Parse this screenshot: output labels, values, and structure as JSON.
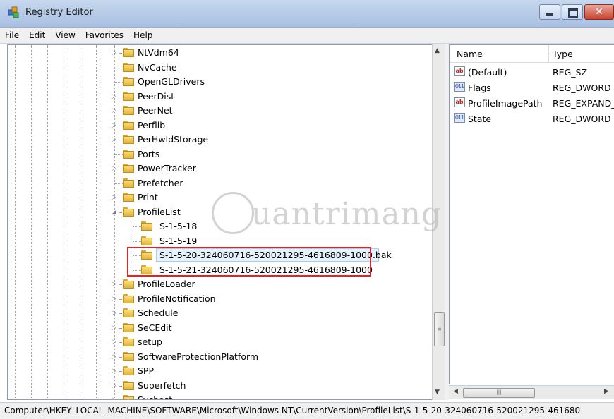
{
  "window": {
    "title": "Registry Editor"
  },
  "menu": [
    "File",
    "Edit",
    "View",
    "Favorites",
    "Help"
  ],
  "tree": {
    "items": [
      {
        "label": "NtVdm64",
        "expander": "▷",
        "level": 0
      },
      {
        "label": "NvCache",
        "expander": "",
        "level": 0
      },
      {
        "label": "OpenGLDrivers",
        "expander": "",
        "level": 0
      },
      {
        "label": "PeerDist",
        "expander": "▷",
        "level": 0
      },
      {
        "label": "PeerNet",
        "expander": "▷",
        "level": 0
      },
      {
        "label": "Perflib",
        "expander": "▷",
        "level": 0
      },
      {
        "label": "PerHwIdStorage",
        "expander": "▷",
        "level": 0
      },
      {
        "label": "Ports",
        "expander": "",
        "level": 0
      },
      {
        "label": "PowerTracker",
        "expander": "▷",
        "level": 0
      },
      {
        "label": "Prefetcher",
        "expander": "",
        "level": 0
      },
      {
        "label": "Print",
        "expander": "▷",
        "level": 0
      },
      {
        "label": "ProfileList",
        "expander": "◢",
        "level": 0
      },
      {
        "label": "S-1-5-18",
        "expander": "",
        "level": 1
      },
      {
        "label": "S-1-5-19",
        "expander": "",
        "level": 1
      },
      {
        "label": "S-1-5-20-324060716-520021295-4616809-1000.bak",
        "expander": "",
        "level": 1,
        "selected": true
      },
      {
        "label": "S-1-5-21-324060716-520021295-4616809-1000",
        "expander": "",
        "level": 1
      },
      {
        "label": "ProfileLoader",
        "expander": "▷",
        "level": 0
      },
      {
        "label": "ProfileNotification",
        "expander": "▷",
        "level": 0
      },
      {
        "label": "Schedule",
        "expander": "▷",
        "level": 0
      },
      {
        "label": "SeCEdit",
        "expander": "▷",
        "level": 0
      },
      {
        "label": "setup",
        "expander": "▷",
        "level": 0
      },
      {
        "label": "SoftwareProtectionPlatform",
        "expander": "▷",
        "level": 0
      },
      {
        "label": "SPP",
        "expander": "▷",
        "level": 0
      },
      {
        "label": "Superfetch",
        "expander": "▷",
        "level": 0
      },
      {
        "label": "Svchost",
        "expander": "▷",
        "level": 0
      }
    ]
  },
  "values": {
    "columns": {
      "name": "Name",
      "type": "Type"
    },
    "rows": [
      {
        "icon": "string-value-icon",
        "name": "(Default)",
        "type": "REG_SZ"
      },
      {
        "icon": "binary-value-icon",
        "name": "Flags",
        "type": "REG_DWORD"
      },
      {
        "icon": "string-value-icon",
        "name": "ProfileImagePath",
        "type": "REG_EXPAND_"
      },
      {
        "icon": "binary-value-icon",
        "name": "State",
        "type": "REG_DWORD"
      }
    ]
  },
  "statusbar": {
    "path": "Computer\\HKEY_LOCAL_MACHINE\\SOFTWARE\\Microsoft\\Windows NT\\CurrentVersion\\ProfileList\\S-1-5-20-324060716-520021295-461680"
  },
  "watermark": {
    "text": "uantrimang"
  },
  "colors": {
    "highlight_border": "#e0222b",
    "selection": "#e5f1fb",
    "folder": "#f1c95a"
  }
}
